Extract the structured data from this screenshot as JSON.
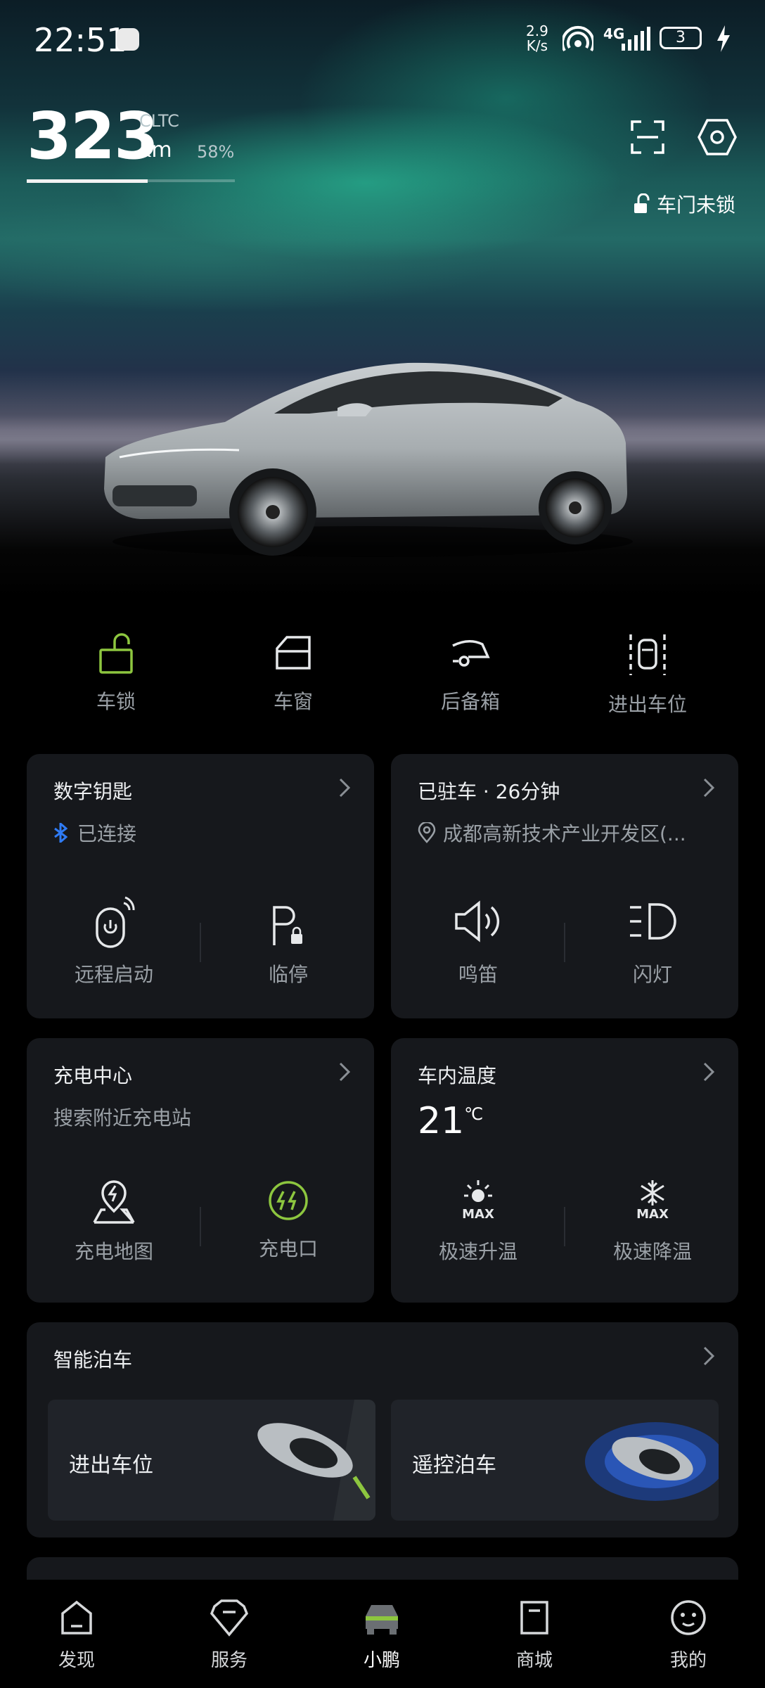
{
  "status_bar": {
    "time": "22:51",
    "net_speed_value": "2.9",
    "net_speed_unit": "K/s",
    "signal_label": "4G",
    "battery": "3",
    "icons": [
      "hotspot-icon",
      "signal-icon",
      "charging-bolt-icon"
    ]
  },
  "vehicle": {
    "range_value": "323",
    "range_standard": "CLTC",
    "range_unit": "km",
    "battery_percent": "58%",
    "battery_fraction": 0.58,
    "door_status": "车门未锁",
    "top_icons": [
      "scan-icon",
      "settings-icon"
    ]
  },
  "quick_controls": [
    {
      "label": "车锁",
      "icon": "unlock-icon",
      "color": "#8dc63f"
    },
    {
      "label": "车窗",
      "icon": "window-icon"
    },
    {
      "label": "后备箱",
      "icon": "trunk-icon"
    },
    {
      "label": "进出车位",
      "icon": "parking-slot-icon"
    }
  ],
  "digital_key": {
    "title": "数字钥匙",
    "status": "已连接",
    "bluetooth_color": "#2f7bf5",
    "actions": [
      {
        "label": "远程启动",
        "icon": "remote-start-icon"
      },
      {
        "label": "临停",
        "icon": "temporary-parking-icon"
      }
    ]
  },
  "parked": {
    "title": "已驻车 · 26分钟",
    "location": "成都高新技术产业开发区(...",
    "actions": [
      {
        "label": "鸣笛",
        "icon": "horn-icon"
      },
      {
        "label": "闪灯",
        "icon": "flash-lights-icon"
      }
    ]
  },
  "charging": {
    "title": "充电中心",
    "subtitle": "搜索附近充电站",
    "actions": [
      {
        "label": "充电地图",
        "icon": "charging-map-icon"
      },
      {
        "label": "充电口",
        "icon": "charge-port-icon",
        "color": "#8dc63f"
      }
    ]
  },
  "cabin_temp": {
    "title": "车内温度",
    "value": "21",
    "unit": "℃",
    "max_label": "MAX",
    "actions": [
      {
        "label": "极速升温",
        "icon": "max-heat-icon"
      },
      {
        "label": "极速降温",
        "icon": "max-cool-icon"
      }
    ]
  },
  "smart_parking": {
    "title": "智能泊车",
    "options": [
      {
        "label": "进出车位"
      },
      {
        "label": "遥控泊车"
      }
    ]
  },
  "bottom_nav": [
    {
      "label": "发现",
      "icon": "discover-icon"
    },
    {
      "label": "服务",
      "icon": "service-icon"
    },
    {
      "label": "小鹏",
      "icon": "car-icon",
      "active": true,
      "accent": "#8dc63f"
    },
    {
      "label": "商城",
      "icon": "mall-icon"
    },
    {
      "label": "我的",
      "icon": "profile-icon"
    }
  ]
}
